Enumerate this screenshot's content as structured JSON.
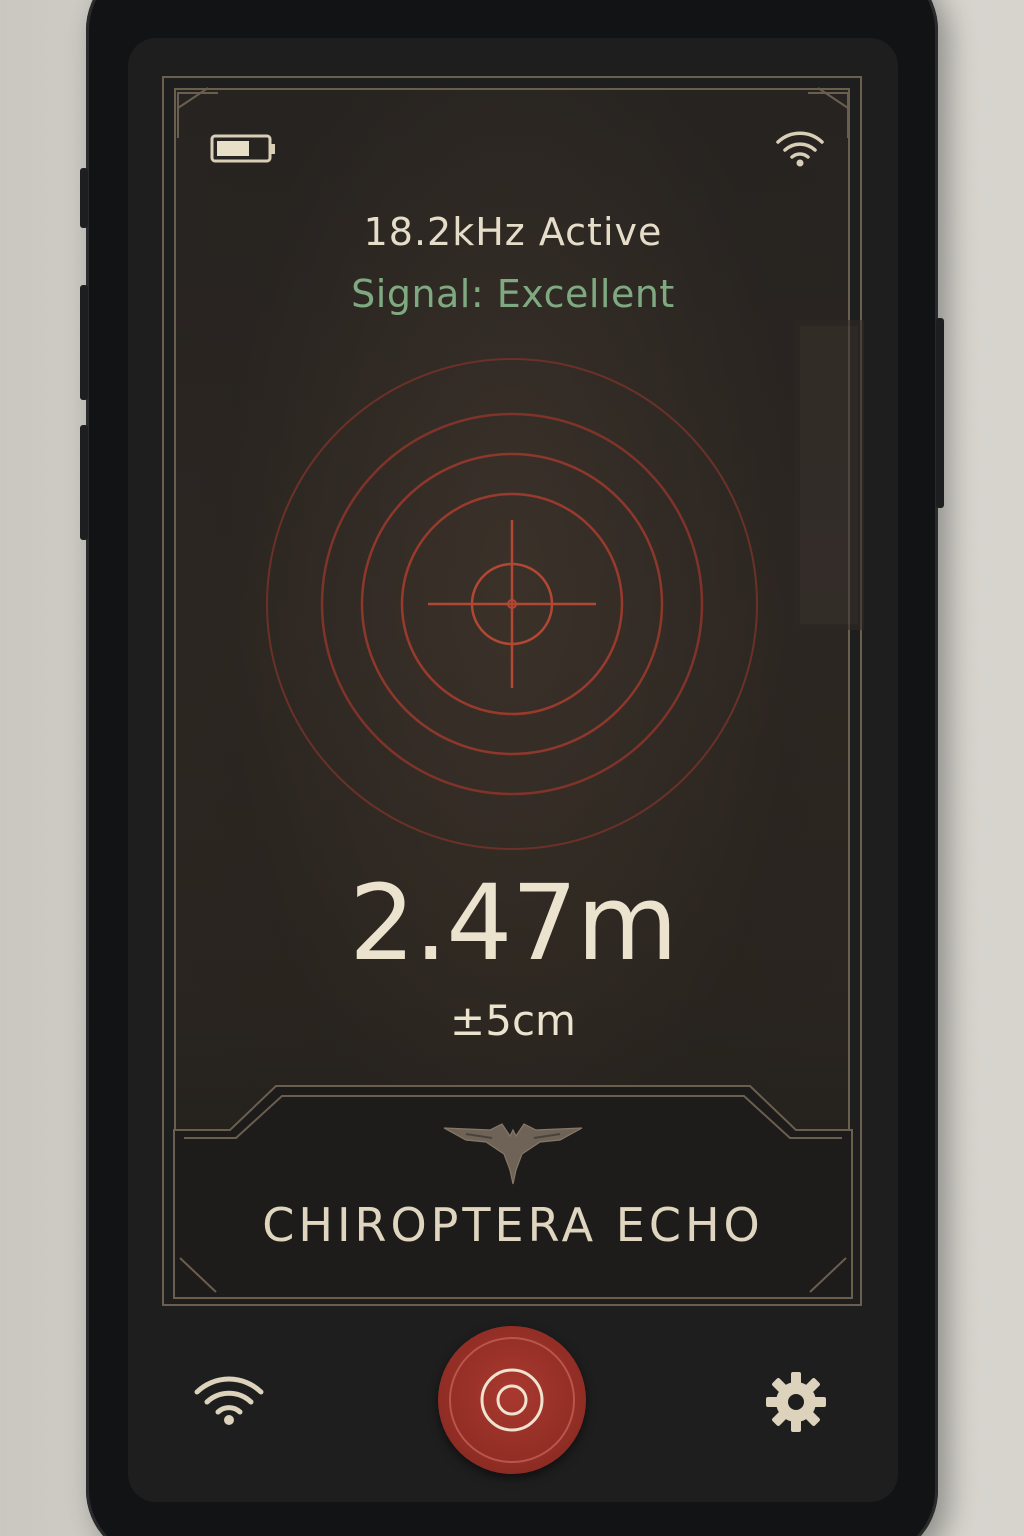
{
  "status_bar": {
    "battery_icon": "battery-icon",
    "wifi_icon": "wifi-icon"
  },
  "readout": {
    "frequency": "18.2kHz Active",
    "signal": "Signal: Excellent",
    "distance": "2.47m",
    "accuracy": "±5cm"
  },
  "branding": {
    "logo_icon": "bat-logo-icon",
    "app_name": "CHIROPTERA ECHO"
  },
  "bottom_nav": {
    "left_icon": "wifi-icon",
    "center_icon": "ping-target-icon",
    "right_icon": "gear-icon"
  },
  "colors": {
    "accent_red": "#a9392f",
    "signal_green": "#7fa981",
    "text_cream": "#ece3cf",
    "frame_bronze": "#6a5e4f"
  }
}
